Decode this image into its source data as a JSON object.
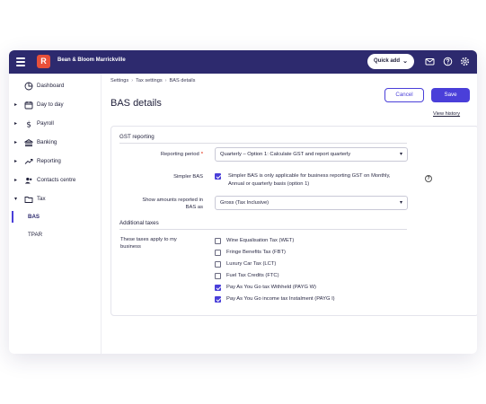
{
  "topbar": {
    "business_name": "Bean & Bloom Marrickville",
    "logo_letter": "R",
    "quick_add_label": "Quick add",
    "colors": {
      "bar": "#2d2a6e",
      "logo": "#e8503a",
      "accent": "#4a3fd9"
    }
  },
  "sidebar": {
    "items": [
      {
        "label": "Dashboard",
        "icon": "dashboard-icon"
      },
      {
        "label": "Day to day",
        "icon": "calendar-icon"
      },
      {
        "label": "Payroll",
        "icon": "dollar-icon"
      },
      {
        "label": "Banking",
        "icon": "bank-icon"
      },
      {
        "label": "Reporting",
        "icon": "trend-icon"
      },
      {
        "label": "Contacts centre",
        "icon": "contacts-icon"
      },
      {
        "label": "Tax",
        "icon": "folder-icon"
      }
    ],
    "sub_items": [
      {
        "label": "BAS",
        "active": true
      },
      {
        "label": "TPAR",
        "active": false
      }
    ]
  },
  "breadcrumb": [
    "Settings",
    "Tax settings",
    "BAS details"
  ],
  "page": {
    "title": "BAS details",
    "cancel_label": "Cancel",
    "save_label": "Save",
    "view_history_label": "View history"
  },
  "gst": {
    "section_title": "GST reporting",
    "reporting_period_label": "Reporting period",
    "reporting_period_value": "Quarterly – Option 1: Calculate GST and report quarterly",
    "simpler_bas_label": "Simpler BAS",
    "simpler_bas_checked": true,
    "simpler_bas_text_line1": "Simpler BAS is only applicable for business reporting GST on Monthly,",
    "simpler_bas_text_line2": "Annual or quarterly basis (option 1)",
    "show_amounts_label_line1": "Show amounts reported in",
    "show_amounts_label_line2": "BAS as",
    "show_amounts_value": "Gross (Tax Inclusive)"
  },
  "additional": {
    "section_title": "Additional taxes",
    "apply_label_line1": "These taxes apply to my",
    "apply_label_line2": "business",
    "taxes": [
      {
        "label": "Wine Equalisation Tax (WET)",
        "checked": false
      },
      {
        "label": "Fringe Benefits Tax (FBT)",
        "checked": false
      },
      {
        "label": "Luxury Car Tax (LCT)",
        "checked": false
      },
      {
        "label": "Fuel Tax Credits (FTC)",
        "checked": false
      },
      {
        "label": "Pay As You Go tax Withheld (PAYG W)",
        "checked": true
      },
      {
        "label": "Pay As You Go income tax Instalment (PAYG I)",
        "checked": true
      }
    ]
  }
}
